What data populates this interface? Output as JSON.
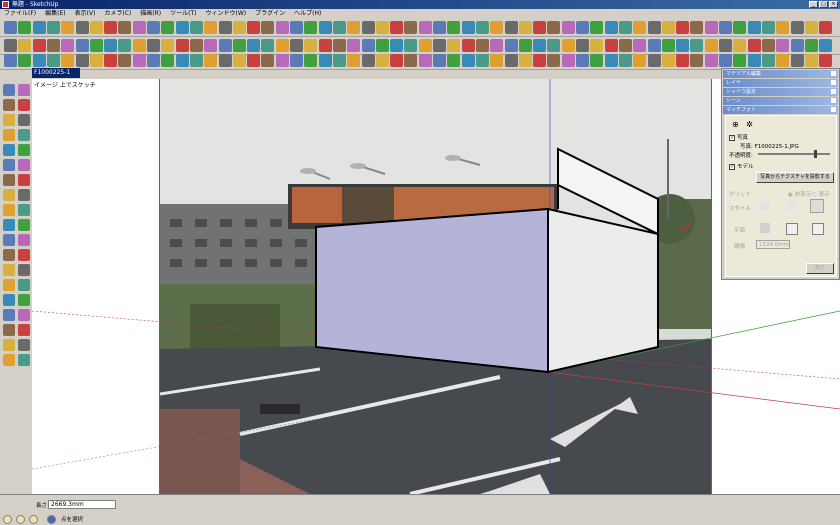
{
  "window": {
    "title": "無題 - SketchUp",
    "buttons": [
      "_",
      "□",
      "×"
    ]
  },
  "menu": [
    "ファイル(F)",
    "編集(E)",
    "表示(V)",
    "カメラ(C)",
    "描画(R)",
    "ツール(T)",
    "ウィンドウ(W)",
    "プラグイン",
    "ヘルプ(H)"
  ],
  "scene_tab": "F1000225-1 (2)",
  "viewport_label": "イメージ 上でスケッチ",
  "panel": {
    "sections": [
      "マテリアル編集",
      "レイヤ",
      "シャドウ設定",
      "シーン",
      "マッチフォト"
    ],
    "photo_label": "写真",
    "photo_file_label": "写真:",
    "photo_file": "F1000225-1.JPG",
    "opacity_label": "不透明度:",
    "model_label": "モデル",
    "project_button": "写真からテクスチャを投影する",
    "grid_label": "グリッド",
    "grid_opt1": "非表示",
    "grid_opt2": "表示",
    "style_label": "スタイル",
    "plane_label": "平面",
    "spacing_label": "間隔",
    "spacing_value": "1524.0mm",
    "done_button": "完了"
  },
  "status": {
    "measure_label": "長さ",
    "measure_value": "2669.3mm",
    "hint": "点を選択"
  }
}
